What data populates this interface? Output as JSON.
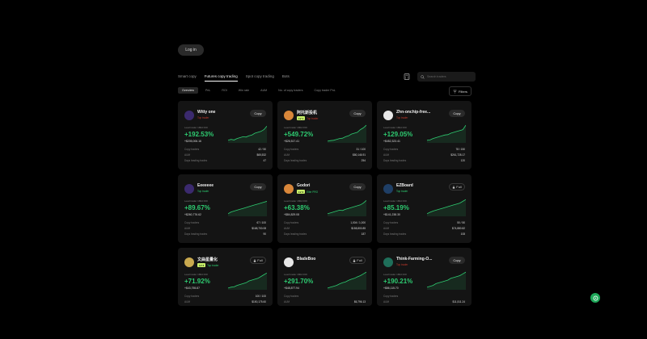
{
  "auth": {
    "login_label": "Log in"
  },
  "tabs": [
    {
      "label": "Smart copy",
      "active": false
    },
    {
      "label": "Futures copy trading",
      "active": true
    },
    {
      "label": "Spot copy trading",
      "active": false
    },
    {
      "label": "Bots",
      "active": false
    }
  ],
  "search": {
    "placeholder": "Search traders"
  },
  "filters": {
    "button_label": "Filters",
    "chips": [
      {
        "label": "Overview",
        "active": true
      },
      {
        "label": "PnL",
        "active": false
      },
      {
        "label": "ROI",
        "active": false
      },
      {
        "label": "Win rate",
        "active": false
      },
      {
        "label": "AUM",
        "active": false
      },
      {
        "label": "No. of copy traders",
        "active": false
      },
      {
        "label": "Copy trader PnL",
        "active": false
      }
    ]
  },
  "colors": {
    "accent_green": "#2ecc71",
    "tag_lime": "#c9f26a",
    "background": "#000000",
    "card": "#141414"
  },
  "traders": [
    {
      "name": "Witty one",
      "tag": "",
      "subtext": "Top trader",
      "sub_color": "red",
      "action": "Copy",
      "avatar_color": "#3b2a6e",
      "avatar_icon": "bird-avatar-icon",
      "pnl_label": "Lead trader 180d ROI",
      "roi": "+192.53%",
      "pnl": "+$205,006.16",
      "copy_traders": "42 / 50",
      "aum": "$65,532",
      "days": "47",
      "spark": [
        0.1,
        0.15,
        0.12,
        0.2,
        0.25,
        0.3,
        0.28,
        0.35,
        0.4,
        0.5,
        0.55,
        0.6,
        0.7,
        0.9
      ]
    },
    {
      "name": "阿托斯投机",
      "tag": "LV 1",
      "subtext": "Top trader",
      "sub_color": "red",
      "action": "Copy",
      "avatar_color": "#d9873a",
      "avatar_icon": "cartoon-avatar-icon",
      "pnl_label": "Lead trader 180d ROI",
      "roi": "+549.72%",
      "pnl": "+$26,517.41",
      "copy_traders": "31 / 100",
      "aum": "$80,146.91",
      "days": "254",
      "spark": [
        0.05,
        0.08,
        0.1,
        0.15,
        0.2,
        0.22,
        0.3,
        0.35,
        0.45,
        0.5,
        0.55,
        0.7,
        0.8,
        0.95
      ]
    },
    {
      "name": "Zhn-onchip-free...",
      "tag": "",
      "subtext": "Top trader",
      "sub_color": "red",
      "action": "Copy",
      "avatar_color": "#e8e8e8",
      "avatar_icon": "pet-avatar-icon",
      "pnl_label": "Lead trader 180d ROI",
      "roi": "+129.05%",
      "pnl": "+$452,323.41",
      "copy_traders": "78 / 150",
      "aum": "$261,728.17",
      "days": "120",
      "spark": [
        0.1,
        0.12,
        0.2,
        0.25,
        0.3,
        0.35,
        0.4,
        0.42,
        0.5,
        0.55,
        0.6,
        0.65,
        0.7,
        0.95
      ]
    },
    {
      "name": "Eeeeeee",
      "tag": "",
      "subtext": "Top trader",
      "sub_color": "green",
      "action": "Copy",
      "avatar_color": "#3b2a6e",
      "avatar_icon": "bird-avatar-icon",
      "pnl_label": "Lead trader 180d ROI",
      "roi": "+89.67%",
      "pnl": "+$260,776.62",
      "copy_traders": "67 / 100",
      "aum": "$168,700.08",
      "days": "90",
      "spark": [
        0.1,
        0.2,
        0.25,
        0.3,
        0.35,
        0.4,
        0.45,
        0.5,
        0.55,
        0.6,
        0.65,
        0.7,
        0.75,
        0.8
      ]
    },
    {
      "name": "Godori",
      "tag": "LV 3",
      "subtext": "Elite PRO",
      "sub_color": "green",
      "action": "Copy",
      "avatar_color": "#d9873a",
      "avatar_icon": "cartoon-avatar-icon",
      "pnl_label": "Lead trader 180d ROI",
      "roi": "+63.38%",
      "pnl": "+$84,829.08",
      "copy_traders": "1,004 / 1,000",
      "aum": "$158,800.85",
      "days": "187",
      "spark": [
        0.1,
        0.15,
        0.2,
        0.25,
        0.3,
        0.28,
        0.35,
        0.4,
        0.45,
        0.5,
        0.55,
        0.6,
        0.7,
        0.85
      ]
    },
    {
      "name": "EZBoard",
      "tag": "",
      "subtext": "Top trader",
      "sub_color": "green",
      "action": "Full",
      "avatar_color": "#1f3f66",
      "avatar_icon": "logo-avatar-icon",
      "pnl_label": "Lead trader 180d ROI",
      "roi": "+85.19%",
      "pnl": "+$141,238.30",
      "copy_traders": "50 / 50",
      "aum": "$74,880.82",
      "days": "108",
      "spark": [
        0.1,
        0.18,
        0.25,
        0.3,
        0.35,
        0.4,
        0.45,
        0.5,
        0.55,
        0.6,
        0.65,
        0.7,
        0.8,
        0.9
      ]
    },
    {
      "name": "文曲星量化",
      "tag": "LV 3",
      "subtext": "Top trader",
      "sub_color": "green",
      "action": "Full",
      "avatar_color": "#c9a94f",
      "avatar_icon": "star-avatar-icon",
      "pnl_label": "Lead trader 180d ROI",
      "roi": "+71.92%",
      "pnl": "+$43,755.87",
      "copy_traders": "100 / 100",
      "aum": "$150,175.60",
      "days": "",
      "spark": [
        0.05,
        0.1,
        0.12,
        0.2,
        0.25,
        0.3,
        0.35,
        0.45,
        0.5,
        0.55,
        0.6,
        0.7,
        0.8,
        0.9
      ]
    },
    {
      "name": "BladeBoo",
      "tag": "",
      "subtext": "",
      "sub_color": "green",
      "action": "Full",
      "avatar_color": "#e8e8e8",
      "avatar_icon": "pet-avatar-icon",
      "pnl_label": "Lead trader 180d ROI",
      "roi": "+291.70%",
      "pnl": "+$48,877.94",
      "copy_traders": "",
      "aum": "$6,796.13",
      "days": "",
      "spark": [
        0.05,
        0.1,
        0.15,
        0.2,
        0.28,
        0.35,
        0.4,
        0.48,
        0.55,
        0.6,
        0.68,
        0.75,
        0.85,
        0.95
      ]
    },
    {
      "name": "Think-Farming-O...",
      "tag": "",
      "subtext": "Top trader",
      "sub_color": "red",
      "action": "Copy",
      "avatar_color": "#1f6f5a",
      "avatar_icon": "leaf-avatar-icon",
      "pnl_label": "Lead trader 180d ROI",
      "roi": "+190.21%",
      "pnl": "+$86,115.70",
      "copy_traders": "",
      "aum": "$11,511.24",
      "days": "",
      "spark": [
        0.1,
        0.15,
        0.2,
        0.3,
        0.35,
        0.4,
        0.45,
        0.5,
        0.6,
        0.65,
        0.7,
        0.75,
        0.85,
        0.95
      ]
    }
  ],
  "stat_labels": {
    "copy_traders": "Copy traders",
    "aum": "AUM",
    "days": "Days leading trades"
  }
}
